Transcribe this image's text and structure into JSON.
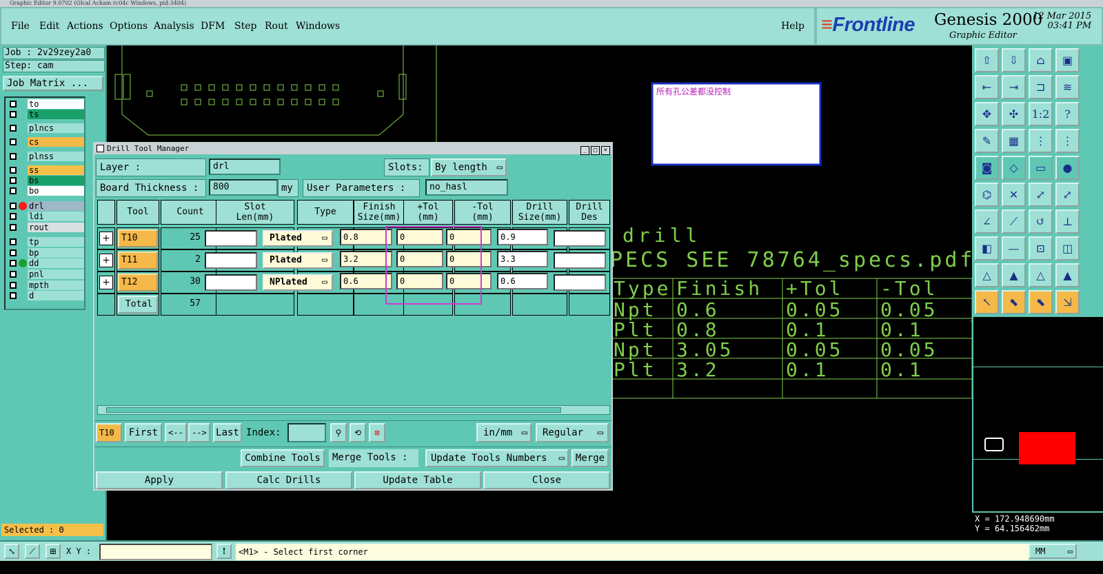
{
  "window": {
    "title": "Graphic Editor 9.0702 (Olcal Ackam rc04c Windows, pid:3404)"
  },
  "menu": {
    "items": [
      "File",
      "Edit",
      "Actions",
      "Options",
      "Analysis",
      "DFM",
      "Step",
      "Rout",
      "Windows"
    ],
    "help": "Help"
  },
  "brand": {
    "logo": "Frontline",
    "product": "Genesis 2000",
    "subtitle": "Graphic Editor",
    "date": "12 Mar 2015",
    "time": "03:41 PM"
  },
  "left": {
    "job": "Job : 2v29zey2a0",
    "step": "Step: cam",
    "job_matrix": "Job Matrix ...",
    "layers": [
      {
        "name": "to",
        "color": "#ffffff"
      },
      {
        "name": "ts",
        "color": "#1aa06a"
      },
      {
        "name": "plncs",
        "color": "#9fe0d6"
      },
      {
        "name": "cs",
        "color": "#f5b94a"
      },
      {
        "name": "plnss",
        "color": "#9fe0d6"
      },
      {
        "name": "ss",
        "color": "#f5c04a"
      },
      {
        "name": "bs",
        "color": "#1aa06a"
      },
      {
        "name": "bo",
        "color": "#ffffff"
      },
      {
        "name": "drl",
        "color": "#9fb8c8"
      },
      {
        "name": "ldi",
        "color": "#9fe0d6"
      },
      {
        "name": "rout",
        "color": "#d8e0e0"
      },
      {
        "name": "tp",
        "color": "#9fe0d6"
      },
      {
        "name": "bp",
        "color": "#9fe0d6"
      },
      {
        "name": "dd",
        "color": "#9fe0d6"
      },
      {
        "name": "pnl",
        "color": "#9fe0d6"
      },
      {
        "name": "mpth",
        "color": "#9fe0d6"
      },
      {
        "name": "d",
        "color": "#9fe0d6"
      }
    ],
    "selected": "Selected : 0"
  },
  "canvas": {
    "note": "所有孔公差都没控制",
    "drill_text": "drill",
    "spec_text": "PECS SEE 78764_specs.pdf",
    "table_headers": [
      "Type",
      "Finish",
      "+Tol",
      "-Tol"
    ],
    "table_rows": [
      [
        "Npt",
        "0.6",
        "0.05",
        "0.05"
      ],
      [
        "Plt",
        "0.8",
        "0.1",
        "0.1"
      ],
      [
        "Npt",
        "3.05",
        "0.05",
        "0.05"
      ],
      [
        "Plt",
        "3.2",
        "0.1",
        "0.1"
      ]
    ]
  },
  "dialog": {
    "title": "Drill Tool Manager",
    "layer_label": "Layer          :",
    "layer_value": "drl",
    "slots_label": "Slots:",
    "slots_value": "By length",
    "board_thickness_label": "Board Thickness :",
    "board_thickness_value": "800",
    "board_thickness_unit": "my",
    "user_params_label": "User Parameters :",
    "user_params_value": "no_hasl",
    "columns": [
      "Tool",
      "Count",
      "Slot\nLen(mm)",
      "Type",
      "Finish\nSize(mm)",
      "+Tol\n(mm)",
      "-Tol\n(mm)",
      "Drill\nSize(mm)",
      "Drill\nDes"
    ],
    "rows": [
      {
        "tool": "T10",
        "count": "25",
        "type": "Plated",
        "finish": "0.8",
        "ptol": "0",
        "mtol": "0",
        "drill": "0.9"
      },
      {
        "tool": "T11",
        "count": "2",
        "type": "Plated",
        "finish": "3.2",
        "ptol": "0",
        "mtol": "0",
        "drill": "3.3"
      },
      {
        "tool": "T12",
        "count": "30",
        "type": "NPlated",
        "finish": "0.6",
        "ptol": "0",
        "mtol": "0",
        "drill": "0.6"
      }
    ],
    "total_label": "Total",
    "total_count": "57",
    "nav": {
      "current": "T10",
      "first": "First",
      "prev": "<--",
      "next": "-->",
      "last": "Last",
      "index_label": "Index:",
      "units": "in/mm",
      "mode": "Regular"
    },
    "actions": {
      "combine": "Combine Tools",
      "merge": "Merge Tools :",
      "update_numbers": "Update Tools Numbers",
      "merge_btn": "Merge"
    },
    "footer": {
      "apply": "Apply",
      "calc": "Calc Drills",
      "update": "Update Table",
      "close": "Close"
    }
  },
  "coords": {
    "x": "X =  172.948690mm",
    "y": "Y =  64.156462mm"
  },
  "bottom": {
    "xy_label": "X Y :",
    "prompt": "<M1> - Select first corner",
    "units": "MM"
  }
}
